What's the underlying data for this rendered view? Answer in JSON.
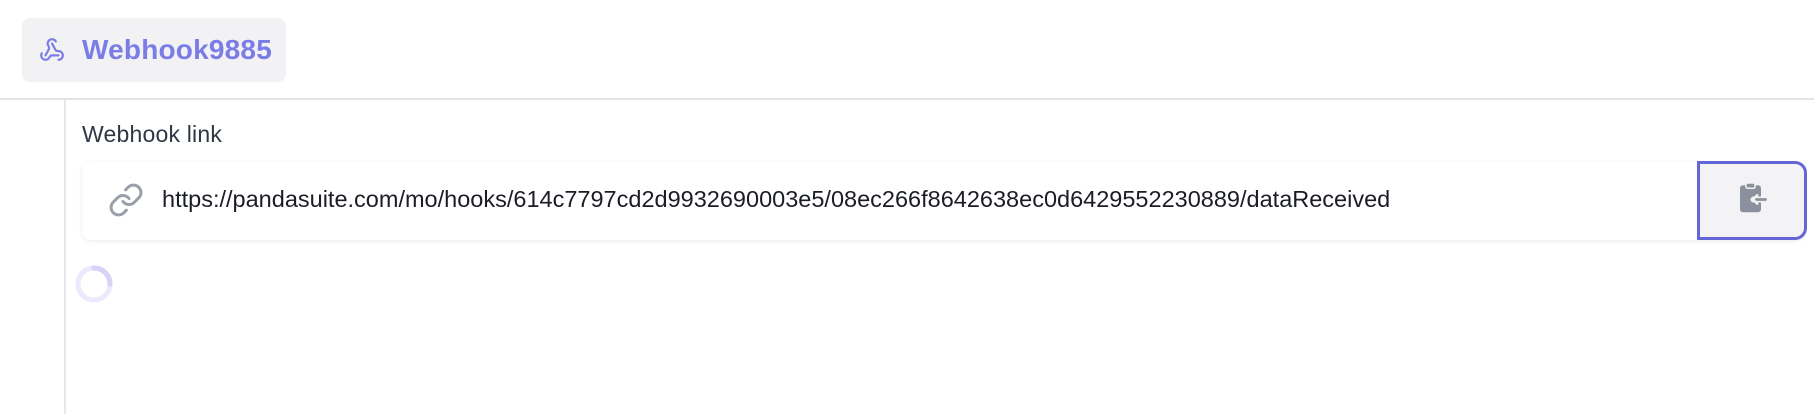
{
  "tab": {
    "label": "Webhook9885",
    "icon": "webhook-icon"
  },
  "section": {
    "label": "Webhook link"
  },
  "webhook": {
    "url": "https://pandasuite.com/mo/hooks/614c7797cd2d9932690003e5/08ec266f8642638ec0d6429552230889/dataReceived",
    "link_icon": "link-icon",
    "copy_icon": "clipboard-copy-icon"
  },
  "colors": {
    "accent": "#7b7de6",
    "focus_border": "#6466d8",
    "tab_background": "#f2f2f4",
    "text": "#1a1d23",
    "muted_icon": "#9aa0aa"
  }
}
